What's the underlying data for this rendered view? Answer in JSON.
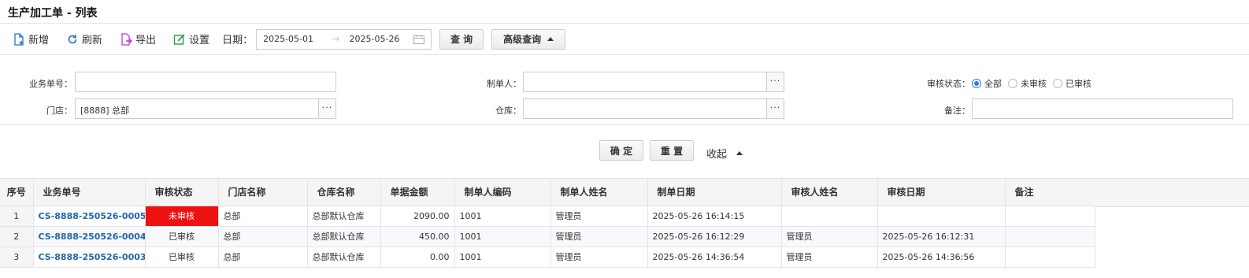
{
  "page_title": "生产加工单 - 列表",
  "toolbar": {
    "add_label": "新增",
    "refresh_label": "刷新",
    "export_label": "导出",
    "settings_label": "设置",
    "date_label": "日期：",
    "date_start": "2025-05-01",
    "date_end": "2025-05-26",
    "date_arrow": "→",
    "query_label": "查 询",
    "advanced_label": "高级查询"
  },
  "filters": {
    "bill_no_label": "业务单号：",
    "bill_no_value": "",
    "creator_label": "制单人：",
    "creator_value": "",
    "status_label": "审核状态：",
    "status_options": [
      "全部",
      "未审核",
      "已审核"
    ],
    "status_selected": "全部",
    "store_label": "门店：",
    "store_value": "[8888] 总部",
    "warehouse_label": "仓库：",
    "warehouse_value": "",
    "remark_label": "备注：",
    "remark_value": "",
    "dots": "···"
  },
  "actions": {
    "confirm_label": "确 定",
    "reset_label": "重 置",
    "collapse_label": "收起"
  },
  "table": {
    "columns": [
      "序号",
      "业务单号",
      "审核状态",
      "门店名称",
      "仓库名称",
      "单据金额",
      "制单人编码",
      "制单人姓名",
      "制单日期",
      "审核人姓名",
      "审核日期",
      "备注"
    ],
    "rows": [
      [
        "1",
        "CS-8888-250526-0005",
        "未审核",
        "总部",
        "总部默认仓库",
        "2090.00",
        "1001",
        "管理员",
        "2025-05-26 16:14:15",
        "",
        "",
        ""
      ],
      [
        "2",
        "CS-8888-250526-0004",
        "已审核",
        "总部",
        "总部默认仓库",
        "450.00",
        "1001",
        "管理员",
        "2025-05-26 16:12:29",
        "管理员",
        "2025-05-26 16:12:31",
        ""
      ],
      [
        "3",
        "CS-8888-250526-0003",
        "已审核",
        "总部",
        "总部默认仓库",
        "0.00",
        "1001",
        "管理员",
        "2025-05-26 14:36:54",
        "管理员",
        "2025-05-26 14:36:56",
        ""
      ]
    ]
  },
  "colors": {
    "pending_status_bg": "#ee1111",
    "link_color": "#2266aa",
    "radio_accent": "#2a7de1"
  }
}
